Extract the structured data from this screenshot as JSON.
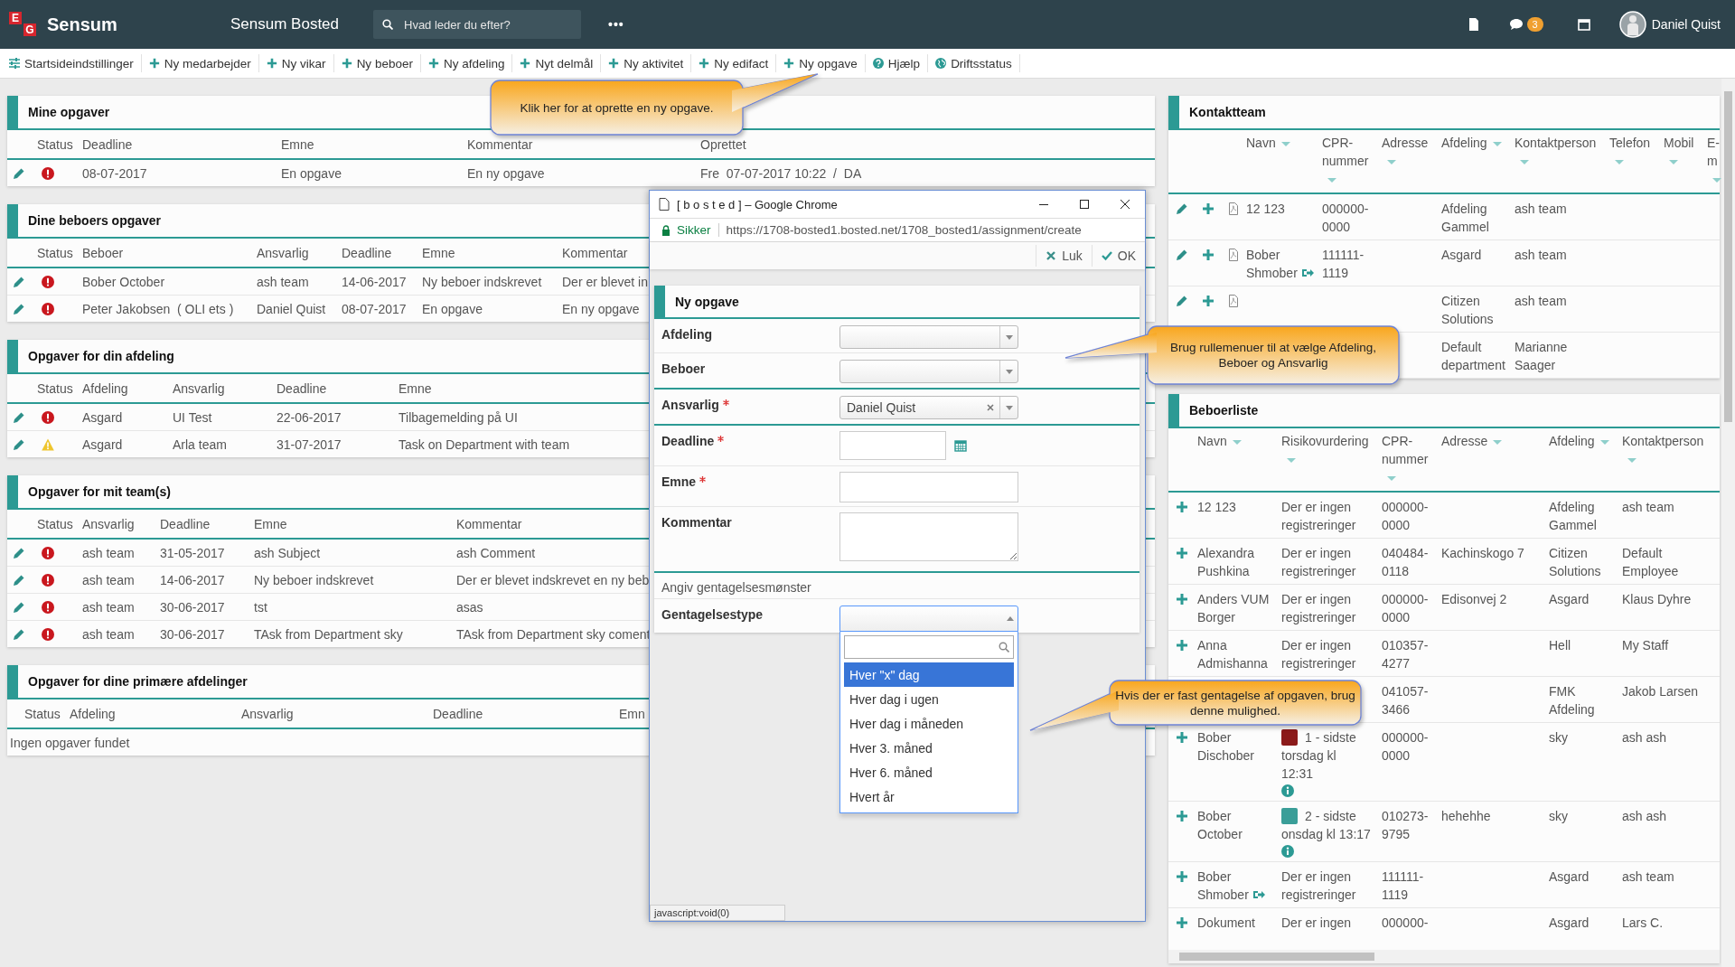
{
  "header": {
    "logo_letters": [
      "E",
      "G"
    ],
    "logo": "Sensum",
    "app_title": "Sensum Bosted",
    "search": {
      "placeholder": "Hvad leder du efter?"
    },
    "more": "•••",
    "chat_count": "3",
    "user": "Daniel Quist"
  },
  "toolbar": [
    {
      "kind": "settings",
      "label": "Startsideindstillinger"
    },
    {
      "kind": "add",
      "label": "Ny medarbejder"
    },
    {
      "kind": "add",
      "label": "Ny vikar"
    },
    {
      "kind": "add",
      "label": "Ny beboer"
    },
    {
      "kind": "add",
      "label": "Ny afdeling"
    },
    {
      "kind": "add",
      "label": "Nyt delmål"
    },
    {
      "kind": "add",
      "label": "Ny aktivitet"
    },
    {
      "kind": "add",
      "label": "Ny edifact"
    },
    {
      "kind": "add",
      "label": "Ny opgave"
    },
    {
      "kind": "help",
      "label": "Hjælp"
    },
    {
      "kind": "status",
      "label": "Driftsstatus"
    }
  ],
  "task_panels": [
    {
      "title": "Mine opgaver",
      "editable": true,
      "status_header": "Status",
      "columns": [
        "Deadline",
        "Emne",
        "Kommentar",
        "Oprettet"
      ],
      "rows": [
        {
          "kind": "error",
          "cells": [
            "08-07-2017",
            "En opgave",
            "En ny opgave",
            "Fre  07-07-2017 10:22  /  DA"
          ]
        }
      ]
    },
    {
      "title": "Dine beboers opgaver",
      "editable": true,
      "status_header": "Status",
      "columns": [
        "Beboer",
        "Ansvarlig",
        "Deadline",
        "Emne",
        "Kommentar"
      ],
      "rows": [
        {
          "kind": "error",
          "cells": [
            "Bober October",
            "ash team",
            "14-06-2017",
            "Ny beboer indskrevet",
            "Der er blevet in"
          ]
        },
        {
          "kind": "error",
          "cells": [
            "Peter Jakobsen  ( OLI ets )",
            "Daniel Quist",
            "08-07-2017",
            "En opgave",
            "En ny opgave"
          ]
        }
      ]
    },
    {
      "title": "Opgaver for din afdeling",
      "editable": true,
      "status_header": "Status",
      "columns": [
        "Afdeling",
        "Ansvarlig",
        "Deadline",
        "Emne"
      ],
      "rows": [
        {
          "kind": "error",
          "cells": [
            "Asgard",
            "UI Test",
            "22-06-2017",
            "Tilbagemelding på UI"
          ]
        },
        {
          "kind": "warning",
          "cells": [
            "Asgard",
            "Arla team",
            "31-07-2017",
            "Task on Department with team"
          ]
        }
      ]
    },
    {
      "title": "Opgaver for mit team(s)",
      "editable": true,
      "status_header": "Status",
      "columns": [
        "Ansvarlig",
        "Deadline",
        "Emne",
        "Kommentar"
      ],
      "rows": [
        {
          "kind": "error",
          "cells": [
            "ash team",
            "31-05-2017",
            "ash Subject",
            "ash Comment"
          ]
        },
        {
          "kind": "error",
          "cells": [
            "ash team",
            "14-06-2017",
            "Ny beboer indskrevet",
            "Der er blevet indskrevet en ny beb"
          ]
        },
        {
          "kind": "error",
          "cells": [
            "ash team",
            "30-06-2017",
            "tst",
            "asas"
          ]
        },
        {
          "kind": "error",
          "cells": [
            "ash team",
            "30-06-2017",
            "TAsk from Department sky",
            "TAsk from Department sky coment"
          ]
        }
      ]
    },
    {
      "title": "Opgaver for dine primære afdelinger",
      "editable": false,
      "status_header": "Status",
      "columns": [
        "Afdeling",
        "Ansvarlig",
        "Deadline",
        "Emn"
      ],
      "empty_text": "Ingen opgaver fundet"
    }
  ],
  "contact_team": {
    "title": "Kontaktteam",
    "columns": [
      {
        "label": "Navn",
        "sortable": true
      },
      {
        "label": "CPR-nummer",
        "sortable": true
      },
      {
        "label": "Adresse",
        "sortable": true
      },
      {
        "label": "Afdeling",
        "sortable": true
      },
      {
        "label": "Kontaktperson",
        "sortable": true
      },
      {
        "label": "Telefon",
        "sortable": true
      },
      {
        "label": "Mobil",
        "sortable": true
      },
      {
        "label": "E-m",
        "sortable": true
      }
    ],
    "rows": [
      {
        "actions": true,
        "moved": false,
        "navn": "12 123",
        "cpr": "000000-0000",
        "afdeling": "Afdeling Gammel",
        "kontaktperson": "ash team"
      },
      {
        "actions": true,
        "moved": true,
        "navn": "Bober Shmober",
        "cpr": "111111-1119",
        "afdeling": "Asgard",
        "kontaktperson": "ash team"
      },
      {
        "actions": true,
        "moved": false,
        "afdeling": "Citizen Solutions",
        "kontaktperson": "ash team"
      },
      {
        "actions": false,
        "moved": false,
        "afdeling": "Default department",
        "kontaktperson": "Marianne Saager"
      }
    ]
  },
  "resident_list": {
    "title": "Beboerliste",
    "columns": [
      {
        "label": "Navn",
        "sortable": true
      },
      {
        "label": "Risikovurdering",
        "sortable": true
      },
      {
        "label": "CPR-nummer",
        "sortable": true
      },
      {
        "label": "Adresse",
        "sortable": true
      },
      {
        "label": "Afdeling",
        "sortable": true
      },
      {
        "label": "Kontaktperson",
        "sortable": true
      }
    ],
    "rows": [
      {
        "actions": true,
        "moved": false,
        "navn": "12 123",
        "risk": {
          "text": "Der er ingen registreringer",
          "info": false
        },
        "cpr": "000000-0000",
        "afdeling": "Afdeling Gammel",
        "kontaktperson": "ash team"
      },
      {
        "actions": true,
        "moved": false,
        "navn": "Alexandra Pushkina",
        "risk": {
          "text": "Der er ingen registreringer",
          "info": false
        },
        "cpr": "040484-0118",
        "adresse": "Kachinskogo 7",
        "afdeling": "Citizen Solutions",
        "kontaktperson": "Default Employee"
      },
      {
        "actions": true,
        "moved": false,
        "navn": "Anders VUM Borger",
        "risk": {
          "text": "Der er ingen registreringer",
          "info": false
        },
        "cpr": "000000-0000",
        "adresse": "Edisonvej 2",
        "afdeling": "Asgard",
        "kontaktperson": "Klaus Dyhre"
      },
      {
        "actions": true,
        "moved": false,
        "navn": "Anna Admishanna",
        "risk": {
          "text": "Der er ingen registreringer",
          "info": false
        },
        "cpr": "010357-4277",
        "afdeling": "Hell",
        "kontaktperson": "My Staff"
      },
      {
        "actions": false,
        "moved": false,
        "cpr": "041057-3466",
        "afdeling": "FMK Afdeling",
        "kontaktperson": "Jakob Larsen"
      },
      {
        "actions": true,
        "moved": false,
        "navn": "Bober Dischober",
        "risk": {
          "text": "1 - sidste torsdag kl 12:31",
          "color": "#8b1a1a",
          "info": true
        },
        "cpr": "000000-0000",
        "afdeling": "sky",
        "kontaktperson": "ash ash"
      },
      {
        "actions": true,
        "moved": false,
        "navn": "Bober October",
        "risk": {
          "text": "2 - sidste onsdag kl 13:17",
          "color": "#3a9e98",
          "info": true
        },
        "cpr": "010273-9795",
        "adresse": "hehehhe",
        "afdeling": "sky",
        "kontaktperson": "ash ash"
      },
      {
        "actions": true,
        "moved": true,
        "navn": "Bober Shmober",
        "risk": {
          "text": "Der er ingen registreringer",
          "info": false
        },
        "cpr": "111111-1119",
        "afdeling": "Asgard",
        "kontaktperson": "ash team"
      },
      {
        "actions": true,
        "moved": false,
        "navn": "Dokument",
        "risk": {
          "text": "Der er ingen",
          "info": false
        },
        "cpr": "000000-",
        "afdeling": "Asgard",
        "kontaktperson": "Lars C."
      }
    ]
  },
  "popup": {
    "title": "[ b o s t e d ] – Google Chrome",
    "secure": "Sikker",
    "url": "https://1708-bosted1.bosted.net/1708_bosted1/assignment/create",
    "actions": [
      {
        "kind": "close",
        "label": "Luk"
      },
      {
        "kind": "confirm",
        "label": "OK"
      }
    ],
    "form": {
      "title": "Ny opgave",
      "groups": [
        [
          {
            "kind": "select",
            "label": "Afdeling",
            "required": false
          },
          {
            "kind": "select",
            "label": "Beboer",
            "required": false
          }
        ],
        [
          {
            "kind": "select",
            "label": "Ansvarlig",
            "required": true,
            "value": "Daniel Quist"
          }
        ],
        [
          {
            "kind": "date",
            "label": "Deadline",
            "required": true
          },
          {
            "kind": "text",
            "label": "Emne",
            "required": true
          },
          {
            "kind": "textarea",
            "label": "Kommentar",
            "required": false
          }
        ]
      ],
      "section": "Angiv gentagelsesmønster",
      "repeat": {
        "label": "Gentagelsestype",
        "expanded": true,
        "options": [
          {
            "label": "Hver \"x\" dag",
            "selected": true
          },
          {
            "label": "Hver dag i ugen",
            "selected": false
          },
          {
            "label": "Hver dag i måneden",
            "selected": false
          },
          {
            "label": "Hver 3. måned",
            "selected": false
          },
          {
            "label": "Hver 6. måned",
            "selected": false
          },
          {
            "label": "Hvert år",
            "selected": false
          }
        ]
      }
    },
    "status_text": "javascript:void(0)"
  },
  "callouts": [
    {
      "text": "Klik her for at oprette en ny opgave."
    },
    {
      "text": "Brug rullemenuer til at vælge Afdeling, Beboer og Ansvarlig"
    },
    {
      "text": "Hvis der er fast gentagelse af opgaven, brug denne mulighed."
    }
  ]
}
